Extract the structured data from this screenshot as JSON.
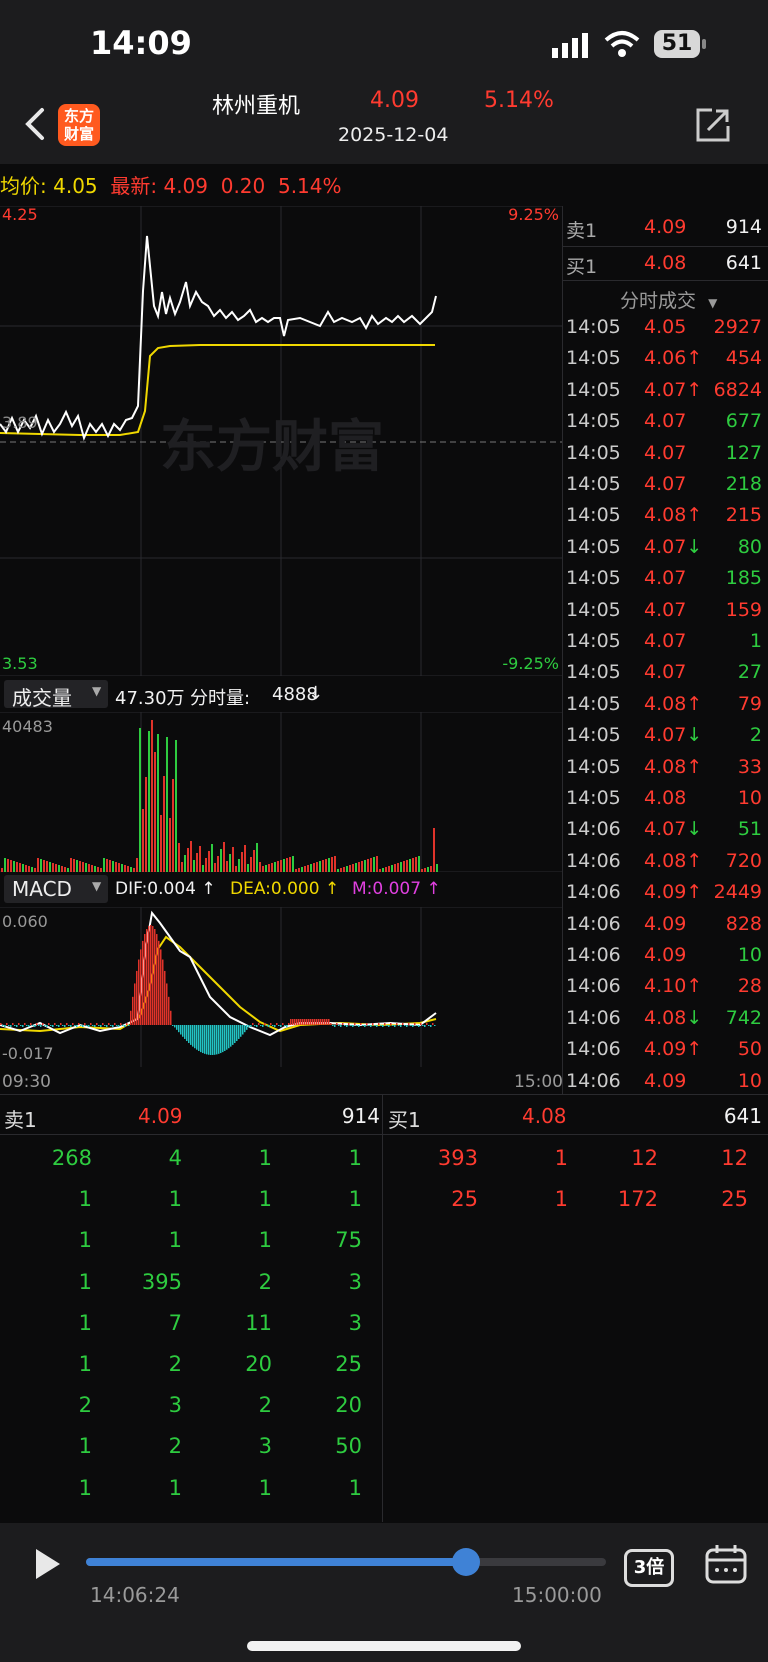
{
  "status_bar": {
    "time": "14:09",
    "battery": "51"
  },
  "header": {
    "logo_text_1": "东方",
    "logo_text_2": "财富",
    "stock_name": "林州重机",
    "price": "4.09",
    "change_pct": "5.14%",
    "date": "2025-12-04"
  },
  "info": {
    "avg_label": "均价:",
    "avg_value": "4.05",
    "latest_label": "最新:",
    "latest_value": "4.09",
    "change": "0.20",
    "change_pct": "5.14%"
  },
  "price_chart": {
    "y_max": "4.25",
    "y_min": "3.53",
    "pct_max": "9.25%",
    "pct_min": "-9.25%",
    "prev_close": "3.89",
    "watermark": "东方财富"
  },
  "volume": {
    "selector": "成交量",
    "total": "47.30万",
    "minute_label": "分时量:",
    "minute_value": "4888",
    "max_label": "40483"
  },
  "macd": {
    "selector": "MACD",
    "dif": "DIF:0.004",
    "dea": "DEA:0.000",
    "m": "M:0.007",
    "max": "0.060",
    "min": "-0.017"
  },
  "time_axis": {
    "start": "09:30",
    "end": "15:00"
  },
  "quote": {
    "sell_label": "卖1",
    "sell_price": "4.09",
    "sell_vol": "914",
    "buy_label": "买1",
    "buy_price": "4.08",
    "buy_vol": "641"
  },
  "ticks_header": "分时成交",
  "ticks": [
    {
      "t": "14:05",
      "p": "4.05",
      "arrow": "",
      "v": "2927",
      "vc": "red"
    },
    {
      "t": "14:05",
      "p": "4.06",
      "arrow": "↑",
      "v": "454",
      "vc": "red"
    },
    {
      "t": "14:05",
      "p": "4.07",
      "arrow": "↑",
      "v": "6824",
      "vc": "red"
    },
    {
      "t": "14:05",
      "p": "4.07",
      "arrow": "",
      "v": "677",
      "vc": "green"
    },
    {
      "t": "14:05",
      "p": "4.07",
      "arrow": "",
      "v": "127",
      "vc": "green"
    },
    {
      "t": "14:05",
      "p": "4.07",
      "arrow": "",
      "v": "218",
      "vc": "green"
    },
    {
      "t": "14:05",
      "p": "4.08",
      "arrow": "↑",
      "v": "215",
      "vc": "red"
    },
    {
      "t": "14:05",
      "p": "4.07",
      "arrow": "↓",
      "v": "80",
      "vc": "green"
    },
    {
      "t": "14:05",
      "p": "4.07",
      "arrow": "",
      "v": "185",
      "vc": "green"
    },
    {
      "t": "14:05",
      "p": "4.07",
      "arrow": "",
      "v": "159",
      "vc": "red"
    },
    {
      "t": "14:05",
      "p": "4.07",
      "arrow": "",
      "v": "1",
      "vc": "green"
    },
    {
      "t": "14:05",
      "p": "4.07",
      "arrow": "",
      "v": "27",
      "vc": "green"
    },
    {
      "t": "14:05",
      "p": "4.08",
      "arrow": "↑",
      "v": "79",
      "vc": "red"
    },
    {
      "t": "14:05",
      "p": "4.07",
      "arrow": "↓",
      "v": "2",
      "vc": "green"
    },
    {
      "t": "14:05",
      "p": "4.08",
      "arrow": "↑",
      "v": "33",
      "vc": "red"
    },
    {
      "t": "14:05",
      "p": "4.08",
      "arrow": "",
      "v": "10",
      "vc": "red"
    },
    {
      "t": "14:06",
      "p": "4.07",
      "arrow": "↓",
      "v": "51",
      "vc": "green"
    },
    {
      "t": "14:06",
      "p": "4.08",
      "arrow": "↑",
      "v": "720",
      "vc": "red"
    },
    {
      "t": "14:06",
      "p": "4.09",
      "arrow": "↑",
      "v": "2449",
      "vc": "red"
    },
    {
      "t": "14:06",
      "p": "4.09",
      "arrow": "",
      "v": "828",
      "vc": "red"
    },
    {
      "t": "14:06",
      "p": "4.09",
      "arrow": "",
      "v": "10",
      "vc": "green"
    },
    {
      "t": "14:06",
      "p": "4.10",
      "arrow": "↑",
      "v": "28",
      "vc": "red"
    },
    {
      "t": "14:06",
      "p": "4.08",
      "arrow": "↓",
      "v": "742",
      "vc": "green"
    },
    {
      "t": "14:06",
      "p": "4.09",
      "arrow": "↑",
      "v": "50",
      "vc": "red"
    },
    {
      "t": "14:06",
      "p": "4.09",
      "arrow": "",
      "v": "10",
      "vc": "red"
    }
  ],
  "sell_queue": [
    [
      "268",
      "4",
      "1",
      "1"
    ],
    [
      "1",
      "1",
      "1",
      "1"
    ],
    [
      "1",
      "1",
      "1",
      "75"
    ],
    [
      "1",
      "395",
      "2",
      "3"
    ],
    [
      "1",
      "7",
      "11",
      "3"
    ],
    [
      "1",
      "2",
      "20",
      "25"
    ],
    [
      "2",
      "3",
      "2",
      "20"
    ],
    [
      "1",
      "2",
      "3",
      "50"
    ],
    [
      "1",
      "1",
      "1",
      "1"
    ]
  ],
  "buy_queue": [
    [
      "393",
      "1",
      "12",
      "12"
    ],
    [
      "25",
      "1",
      "172",
      "25"
    ]
  ],
  "player": {
    "current_time": "14:06:24",
    "end_time": "15:00:00",
    "speed": "3倍",
    "progress": 0.73
  }
}
